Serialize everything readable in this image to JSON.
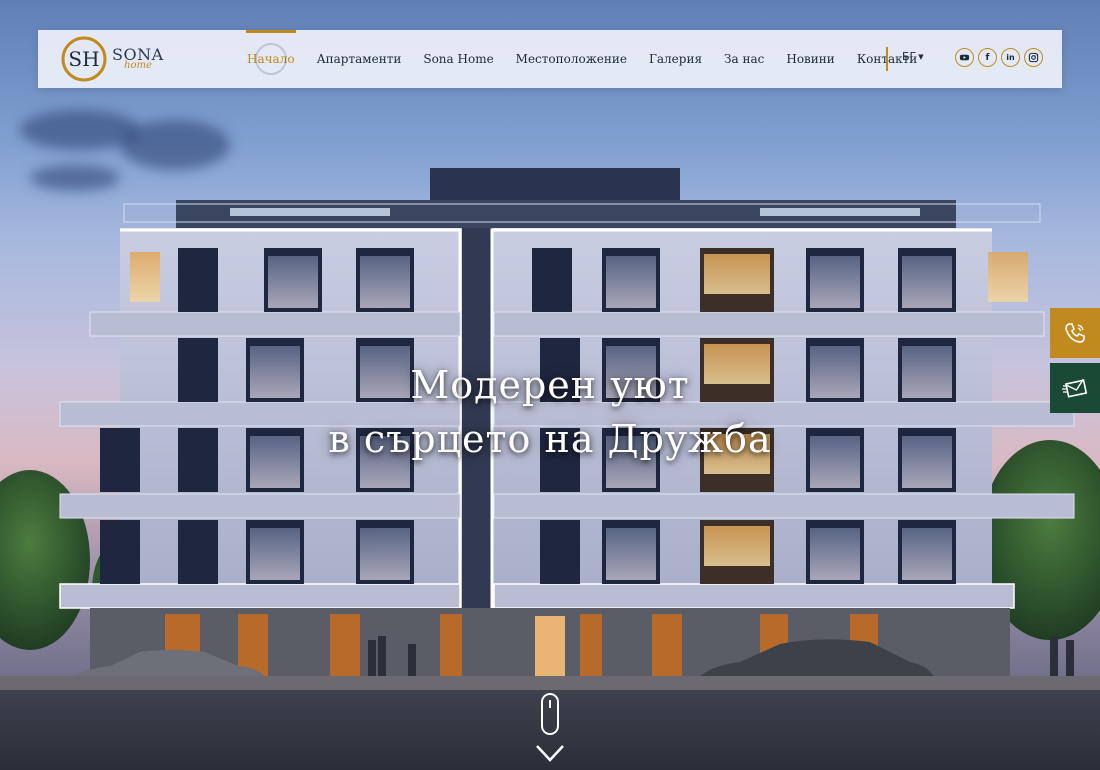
{
  "brand": {
    "monogram": "SH",
    "name": "SONA",
    "sub": "home",
    "accent_color": "#c08a1e"
  },
  "nav": {
    "items": [
      {
        "label": "Начало",
        "active": true
      },
      {
        "label": "Апартаменти"
      },
      {
        "label": "Sona Home"
      },
      {
        "label": "Местоположение"
      },
      {
        "label": "Галерия"
      },
      {
        "label": "За нас"
      },
      {
        "label": "Новини"
      },
      {
        "label": "Контакти"
      }
    ]
  },
  "lang": {
    "current": "БГ"
  },
  "socials": [
    {
      "name": "youtube-icon",
      "glyph": "You"
    },
    {
      "name": "facebook-icon",
      "glyph": "f"
    },
    {
      "name": "linkedin-icon",
      "glyph": "in"
    },
    {
      "name": "instagram-icon",
      "glyph": ""
    }
  ],
  "hero": {
    "line1": "Модерен уют",
    "line2": "в сърцето на Дружба"
  },
  "side_buttons": [
    {
      "name": "phone-icon",
      "color": "#c08a1e"
    },
    {
      "name": "mail-icon",
      "color": "#1a4a35"
    }
  ]
}
